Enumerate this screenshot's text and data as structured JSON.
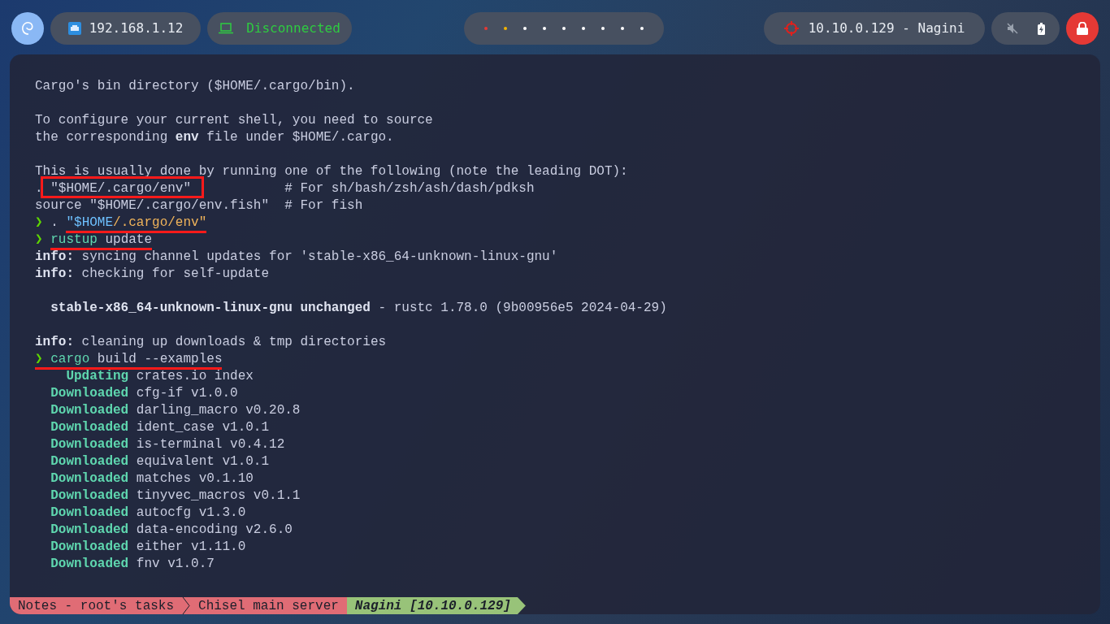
{
  "top_bar": {
    "ip_address": "192.168.1.12",
    "vpn_status": "Disconnected",
    "workspaces": [
      {
        "color": "#e53935"
      },
      {
        "color": "#f4b400"
      },
      {
        "color": "#ffffff"
      },
      {
        "color": "#ffffff"
      },
      {
        "color": "#ffffff"
      },
      {
        "color": "#ffffff"
      },
      {
        "color": "#ffffff"
      },
      {
        "color": "#ffffff"
      },
      {
        "color": "#ffffff"
      }
    ],
    "target": "10.10.0.129 - Nagini",
    "muted": true
  },
  "terminal": {
    "blocks": [
      [
        [
          {
            "kind": "text",
            "text": "Cargo's bin directory ($HOME/.cargo/bin)."
          }
        ]
      ],
      [
        [
          {
            "kind": "text",
            "text": "To configure your current shell, you need to source"
          }
        ],
        [
          {
            "kind": "text",
            "text": "the corresponding "
          },
          {
            "kind": "bold",
            "text": "env"
          },
          {
            "kind": "text",
            "text": " file under $HOME/.cargo."
          }
        ]
      ],
      [
        [
          {
            "kind": "text",
            "text": "This is usually done by running one of the following (note the leading DOT):"
          }
        ],
        [
          {
            "kind": "text",
            "text": ". "
          },
          {
            "kind": "text",
            "text": "\"$HOME/.cargo/env\"",
            "boxed": true
          },
          {
            "kind": "text",
            "text": "            # For sh/bash/zsh/ash/dash/pdksh"
          }
        ],
        [
          {
            "kind": "text",
            "text": "source \"$HOME/.cargo/env.fish\"  # For fish"
          }
        ],
        [
          {
            "kind": "prompt",
            "text": "❯"
          },
          {
            "kind": "text",
            "text": ". "
          },
          {
            "kind": "var",
            "text": "\"$HOME",
            "underlined": true
          },
          {
            "kind": "string",
            "text": "/.cargo/env\"",
            "underlined": true
          }
        ],
        [
          {
            "kind": "prompt",
            "text": "❯"
          },
          {
            "kind": "command",
            "text": "rustup",
            "underlined": true
          },
          {
            "kind": "text",
            "text": " update",
            "underlined": true
          }
        ],
        [
          {
            "kind": "bold",
            "text": "info:"
          },
          {
            "kind": "text",
            "text": " syncing channel updates for 'stable-x86_64-unknown-linux-gnu'"
          }
        ],
        [
          {
            "kind": "bold",
            "text": "info:"
          },
          {
            "kind": "text",
            "text": " checking for self-update"
          }
        ]
      ],
      [
        [
          {
            "kind": "bold",
            "text": "  stable-x86_64-unknown-linux-gnu unchanged"
          },
          {
            "kind": "text",
            "text": " - rustc 1.78.0 (9b00956e5 2024-04-29)"
          }
        ]
      ],
      [
        [
          {
            "kind": "bold",
            "text": "info:"
          },
          {
            "kind": "text",
            "text": " cleaning up downloads & tmp directories"
          }
        ],
        [
          {
            "kind": "prompt",
            "text": "❯",
            "underlined": true
          },
          {
            "kind": "command",
            "text": "cargo",
            "underlined": true
          },
          {
            "kind": "text",
            "text": " build --examples",
            "underlined": true
          }
        ],
        [
          {
            "kind": "status",
            "text": "    Updating"
          },
          {
            "kind": "text",
            "text": " crates.io index"
          }
        ],
        [
          {
            "kind": "status",
            "text": "  Downloaded"
          },
          {
            "kind": "text",
            "text": " cfg-if v1.0.0"
          }
        ],
        [
          {
            "kind": "status",
            "text": "  Downloaded"
          },
          {
            "kind": "text",
            "text": " darling_macro v0.20.8"
          }
        ],
        [
          {
            "kind": "status",
            "text": "  Downloaded"
          },
          {
            "kind": "text",
            "text": " ident_case v1.0.1"
          }
        ],
        [
          {
            "kind": "status",
            "text": "  Downloaded"
          },
          {
            "kind": "text",
            "text": " is-terminal v0.4.12"
          }
        ],
        [
          {
            "kind": "status",
            "text": "  Downloaded"
          },
          {
            "kind": "text",
            "text": " equivalent v1.0.1"
          }
        ],
        [
          {
            "kind": "status",
            "text": "  Downloaded"
          },
          {
            "kind": "text",
            "text": " matches v0.1.10"
          }
        ],
        [
          {
            "kind": "status",
            "text": "  Downloaded"
          },
          {
            "kind": "text",
            "text": " tinyvec_macros v0.1.1"
          }
        ],
        [
          {
            "kind": "status",
            "text": "  Downloaded"
          },
          {
            "kind": "text",
            "text": " autocfg v1.3.0"
          }
        ],
        [
          {
            "kind": "status",
            "text": "  Downloaded"
          },
          {
            "kind": "text",
            "text": " data-encoding v2.6.0"
          }
        ],
        [
          {
            "kind": "status",
            "text": "  Downloaded"
          },
          {
            "kind": "text",
            "text": " either v1.11.0"
          }
        ],
        [
          {
            "kind": "status",
            "text": "  Downloaded"
          },
          {
            "kind": "text",
            "text": " fnv v1.0.7"
          }
        ]
      ]
    ],
    "status_bar": [
      {
        "text": "Notes - root's tasks",
        "selected": false
      },
      {
        "text": "Chisel main server",
        "selected": false
      },
      {
        "text": "Nagini [10.10.0.129]",
        "selected": true
      }
    ]
  }
}
